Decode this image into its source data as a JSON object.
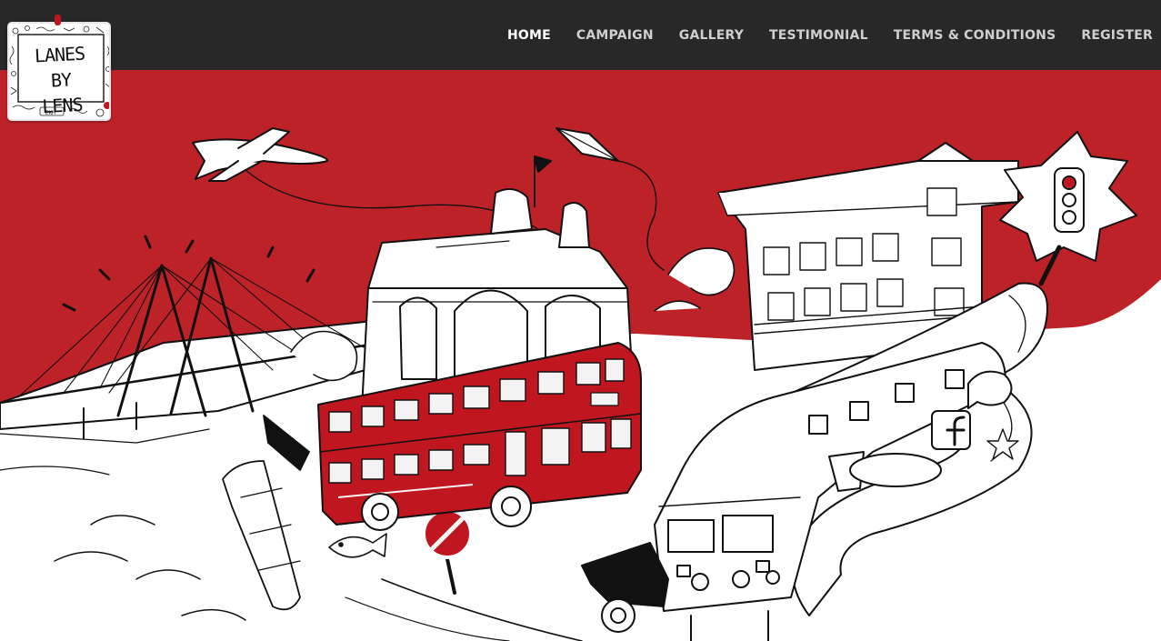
{
  "brand": {
    "logo_lines": [
      "LANES BY",
      "LENS"
    ],
    "logo_tag": "EKM"
  },
  "nav": {
    "items": [
      {
        "label": "HOME",
        "active": true
      },
      {
        "label": "CAMPAIGN",
        "active": false
      },
      {
        "label": "GALLERY",
        "active": false
      },
      {
        "label": "TESTIMONIAL",
        "active": false
      },
      {
        "label": "TERMS & CONDITIONS",
        "active": false
      },
      {
        "label": "REGISTER",
        "active": false
      }
    ]
  },
  "colors": {
    "topbar": "#282828",
    "hero_red": "#be2229",
    "bus_red": "#c0161f",
    "ink": "#111111",
    "nav_active": "#ffffff",
    "nav_inactive": "#cfcfcf"
  },
  "illustration": {
    "icons": [
      "airplane-icon",
      "kite-icon",
      "traffic-signal-icon",
      "facebook-icon",
      "star-icon",
      "no-entry-sign-icon",
      "fish-icon"
    ]
  }
}
